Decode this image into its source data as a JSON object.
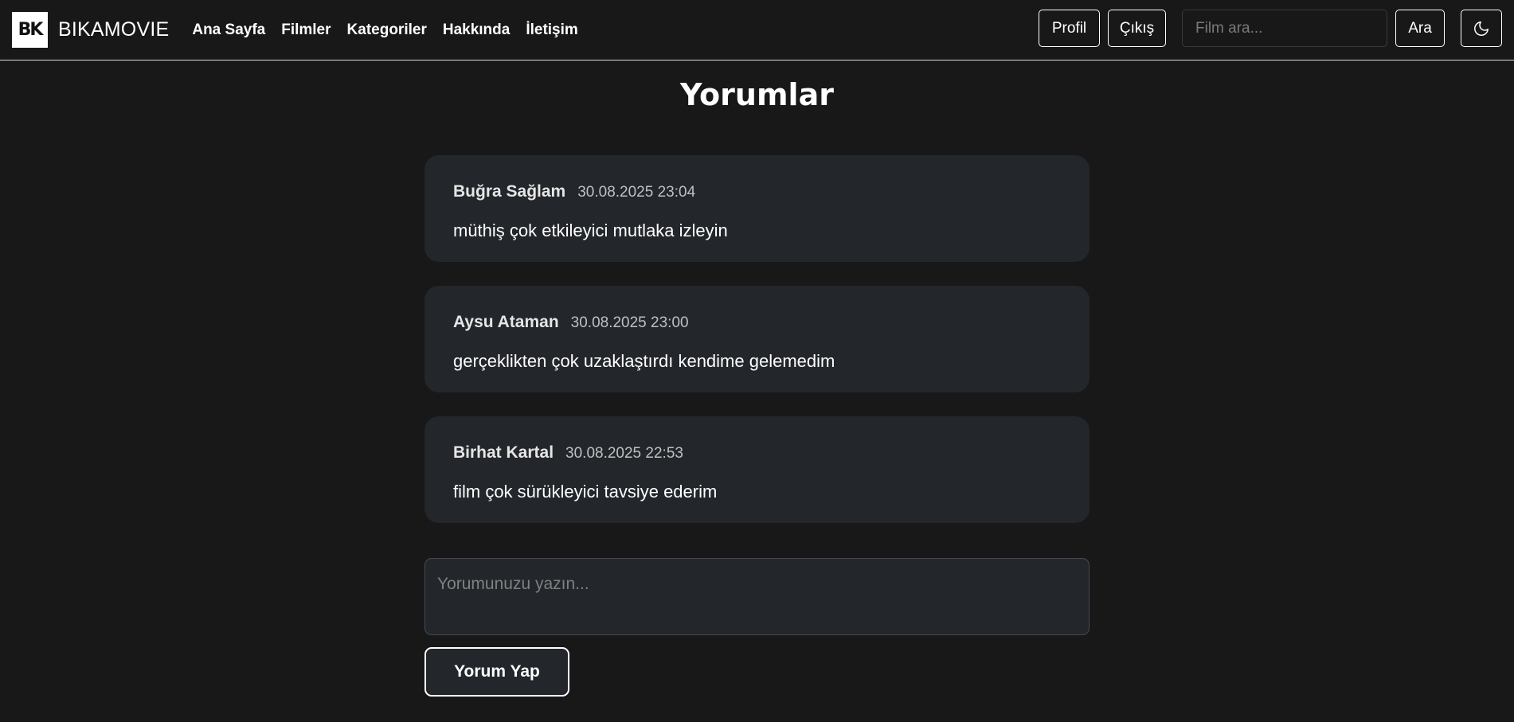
{
  "navbar": {
    "logo_text": "BK",
    "brand": "BIKAMOVIE",
    "links": [
      "Ana Sayfa",
      "Filmler",
      "Kategoriler",
      "Hakkında",
      "İletişim"
    ],
    "profile_label": "Profil",
    "logout_label": "Çıkış",
    "search_placeholder": "Film ara...",
    "search_button": "Ara",
    "theme_icon": "moon-icon"
  },
  "page": {
    "title": "Yorumlar"
  },
  "comments": [
    {
      "author": "Buğra Sağlam",
      "date": "30.08.2025 23:04",
      "text": "müthiş çok etkileyici mutlaka izleyin"
    },
    {
      "author": "Aysu Ataman",
      "date": "30.08.2025 23:00",
      "text": "gerçeklikten çok uzaklaştırdı kendime gelemedim"
    },
    {
      "author": "Birhat Kartal",
      "date": "30.08.2025 22:53",
      "text": "film çok sürükleyici tavsiye ederim"
    }
  ],
  "comment_form": {
    "placeholder": "Yorumunuzu yazın...",
    "submit_label": "Yorum Yap"
  },
  "colors": {
    "background": "#181818",
    "card": "#23262b",
    "text": "#ffffff"
  }
}
